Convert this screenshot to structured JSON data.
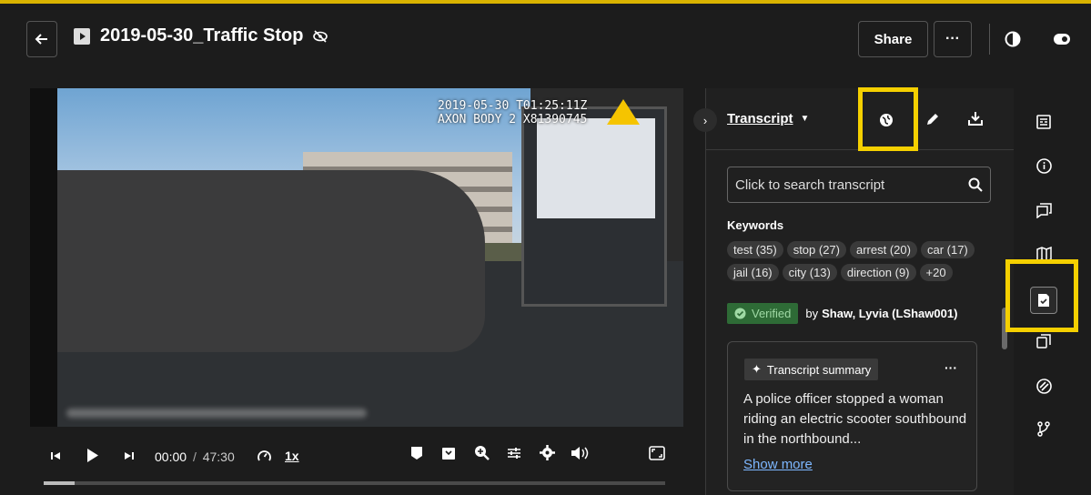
{
  "header": {
    "title": "2019-05-30_Traffic Stop",
    "share_label": "Share",
    "more_label": "···"
  },
  "video": {
    "overlay_line1": "2019-05-30 T01:25:11Z",
    "overlay_line2": "AXON BODY 2 X81390745"
  },
  "player": {
    "current_time": "00:00",
    "separator": "/",
    "duration": "47:30",
    "speed": "1x",
    "progress_fraction": 0.05
  },
  "transcript": {
    "tab_label": "Transcript",
    "search_placeholder": "Click to search transcript",
    "keywords_label": "Keywords",
    "keywords": [
      "test (35)",
      "stop (27)",
      "arrest (20)",
      "car (17)",
      "jail (16)",
      "city (13)",
      "direction (9)",
      "+20"
    ],
    "verified_label": "Verified",
    "verified_by_prefix": "by",
    "verified_by_name": "Shaw, Lyvia (LShaw001)",
    "summary_label": "Transcript summary",
    "summary_more": "···",
    "summary_text": "A police officer stopped a woman riding an electric scooter southbound in the northbound...",
    "show_more": "Show more"
  },
  "icons": {
    "highlight_color": "#f5d000",
    "accent_link": "#7db7ff",
    "verified_bg": "#2e6b36"
  }
}
